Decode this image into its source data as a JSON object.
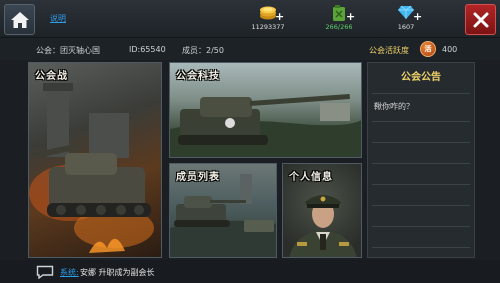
{
  "topbar": {
    "help_link": "说明",
    "resources": [
      {
        "name": "gold-coins-icon",
        "value": "11293377"
      },
      {
        "name": "fuel-can-icon",
        "value": "266/266"
      },
      {
        "name": "diamond-icon",
        "value": "1607"
      }
    ]
  },
  "guild": {
    "name_label": "公会：团灭轴心国",
    "id_label": "ID:65540",
    "members_label": "成员：2/50",
    "activity_label": "公会活跃度",
    "activity_badge": "活",
    "activity_value": "400"
  },
  "cards": {
    "war": "公会战",
    "tech": "公会科技",
    "members": "成员列表",
    "personal": "个人信息"
  },
  "announcement": {
    "title": "公会公告",
    "body": "鞦你咋的？"
  },
  "bottom": {
    "system_link": "系统:",
    "message": "安娜 升职成为副会长"
  },
  "colors": {
    "link": "#2e9de8",
    "close": "#b22424",
    "announce_title": "#f0d36a"
  }
}
